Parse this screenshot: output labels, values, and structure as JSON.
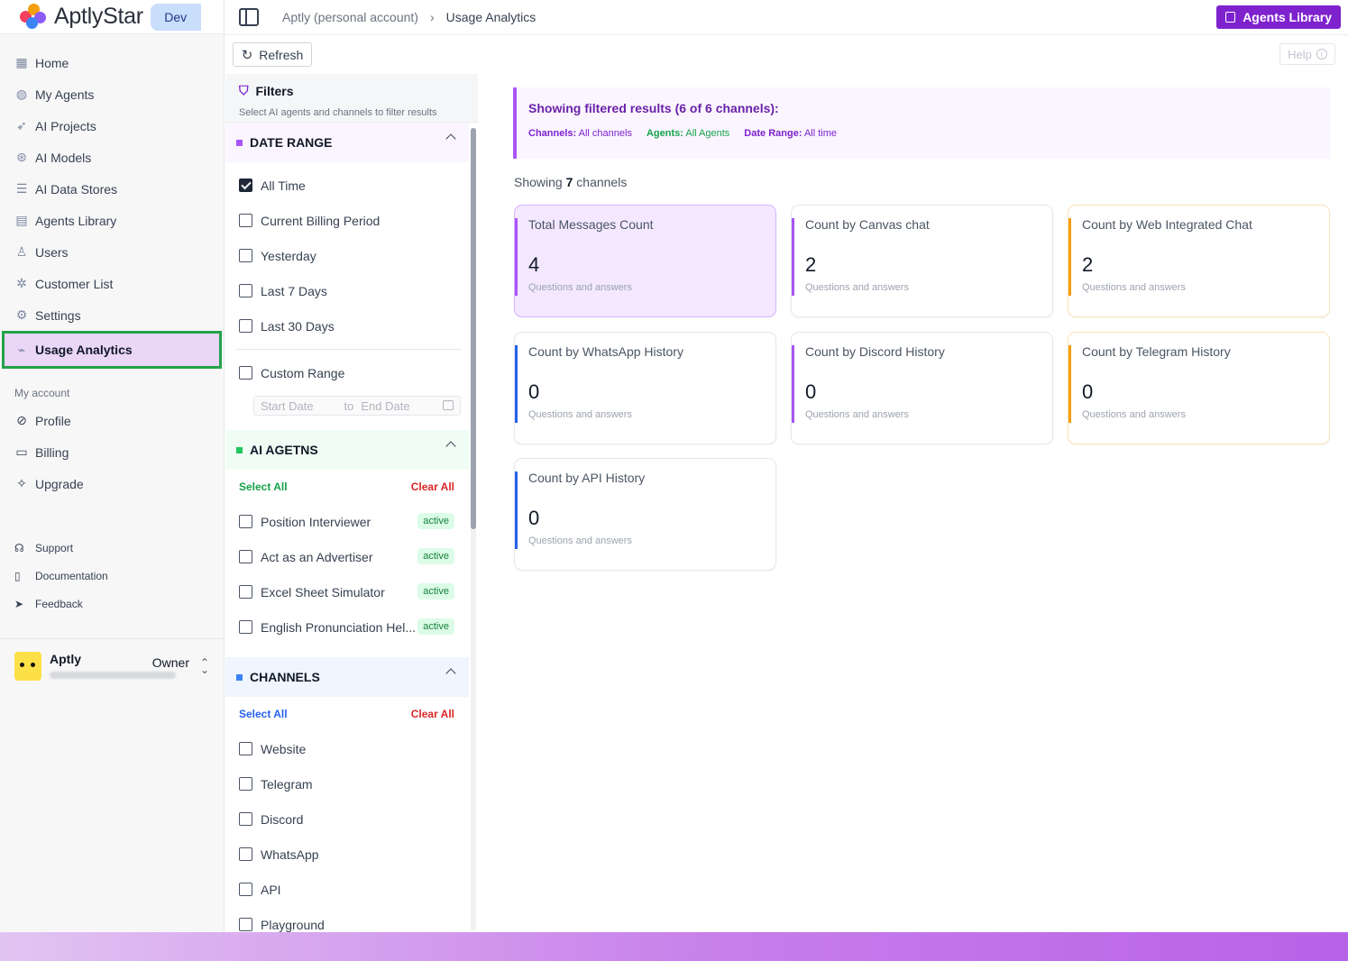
{
  "brand": {
    "name": "AptlyStar",
    "env": "Dev"
  },
  "nav": [
    {
      "label": "Home",
      "icon": "home-icon"
    },
    {
      "label": "My Agents",
      "icon": "robot-icon"
    },
    {
      "label": "AI Projects",
      "icon": "rocket-icon"
    },
    {
      "label": "AI Models",
      "icon": "model-icon"
    },
    {
      "label": "AI Data Stores",
      "icon": "database-icon"
    },
    {
      "label": "Agents Library",
      "icon": "library-icon"
    },
    {
      "label": "Users",
      "icon": "user-icon"
    },
    {
      "label": "Customer List",
      "icon": "customers-icon"
    },
    {
      "label": "Settings",
      "icon": "gear-icon"
    },
    {
      "label": "Usage Analytics",
      "icon": "analytics-icon"
    }
  ],
  "account": {
    "label": "My account",
    "items": [
      {
        "label": "Profile",
        "icon": "profile-icon"
      },
      {
        "label": "Billing",
        "icon": "card-icon"
      },
      {
        "label": "Upgrade",
        "icon": "sparkle-icon"
      }
    ]
  },
  "support": [
    {
      "label": "Support",
      "icon": "headset-icon"
    },
    {
      "label": "Documentation",
      "icon": "book-icon"
    },
    {
      "label": "Feedback",
      "icon": "send-icon"
    }
  ],
  "user": {
    "name": "Aptly",
    "role": "Owner"
  },
  "breadcrumb": {
    "parent": "Aptly (personal account)",
    "current": "Usage Analytics"
  },
  "top_actions": {
    "agents_library": "Agents Library"
  },
  "toolbar": {
    "refresh": "Refresh",
    "help": "Help"
  },
  "filters": {
    "title": "Filters",
    "subtitle": "Select AI agents and channels to filter results",
    "date_range": {
      "title": "DATE RANGE",
      "options": [
        {
          "label": "All Time",
          "checked": true
        },
        {
          "label": "Current Billing Period",
          "checked": false
        },
        {
          "label": "Yesterday",
          "checked": false
        },
        {
          "label": "Last 7 Days",
          "checked": false
        },
        {
          "label": "Last 30 Days",
          "checked": false
        }
      ],
      "custom": "Custom Range",
      "start_placeholder": "Start Date",
      "to": "to",
      "end_placeholder": "End Date"
    },
    "agents": {
      "title": "AI AGETNS",
      "select_all": "Select All",
      "clear_all": "Clear All",
      "items": [
        {
          "label": "Position Interviewer",
          "status": "active"
        },
        {
          "label": "Act as an Advertiser",
          "status": "active"
        },
        {
          "label": "Excel Sheet Simulator",
          "status": "active"
        },
        {
          "label": "English Pronunciation Hel...",
          "status": "active"
        }
      ]
    },
    "channels": {
      "title": "CHANNELS",
      "select_all": "Select All",
      "clear_all": "Clear All",
      "items": [
        "Website",
        "Telegram",
        "Discord",
        "WhatsApp",
        "API",
        "Playground"
      ]
    }
  },
  "banner": {
    "title": "Showing filtered results (6 of 6 channels):",
    "channels_label": "Channels:",
    "channels_value": "All channels",
    "agents_label": "Agents:",
    "agents_value": "All Agents",
    "date_label": "Date Range:",
    "date_value": "All time"
  },
  "showing": {
    "prefix": "Showing",
    "count": "7",
    "suffix": "channels"
  },
  "cards": [
    {
      "title": "Total Messages Count",
      "value": "4",
      "sub": "Questions and answers",
      "accent": "#a855f7"
    },
    {
      "title": "Count by Canvas chat",
      "value": "2",
      "sub": "Questions and answers",
      "accent": "#a855f7"
    },
    {
      "title": "Count by Web Integrated Chat",
      "value": "2",
      "sub": "Questions and answers",
      "accent": "#f59e0b"
    },
    {
      "title": "Count by WhatsApp History",
      "value": "0",
      "sub": "Questions and answers",
      "accent": "#2563eb"
    },
    {
      "title": "Count by Discord History",
      "value": "0",
      "sub": "Questions and answers",
      "accent": "#a855f7"
    },
    {
      "title": "Count by Telegram History",
      "value": "0",
      "sub": "Questions and answers",
      "accent": "#f59e0b"
    },
    {
      "title": "Count by API History",
      "value": "0",
      "sub": "Questions and answers",
      "accent": "#2563eb"
    }
  ],
  "colors": {
    "brand": "#7e22ce",
    "active_nav_bg": "#ead6f7",
    "highlight_border": "#22a34a"
  }
}
